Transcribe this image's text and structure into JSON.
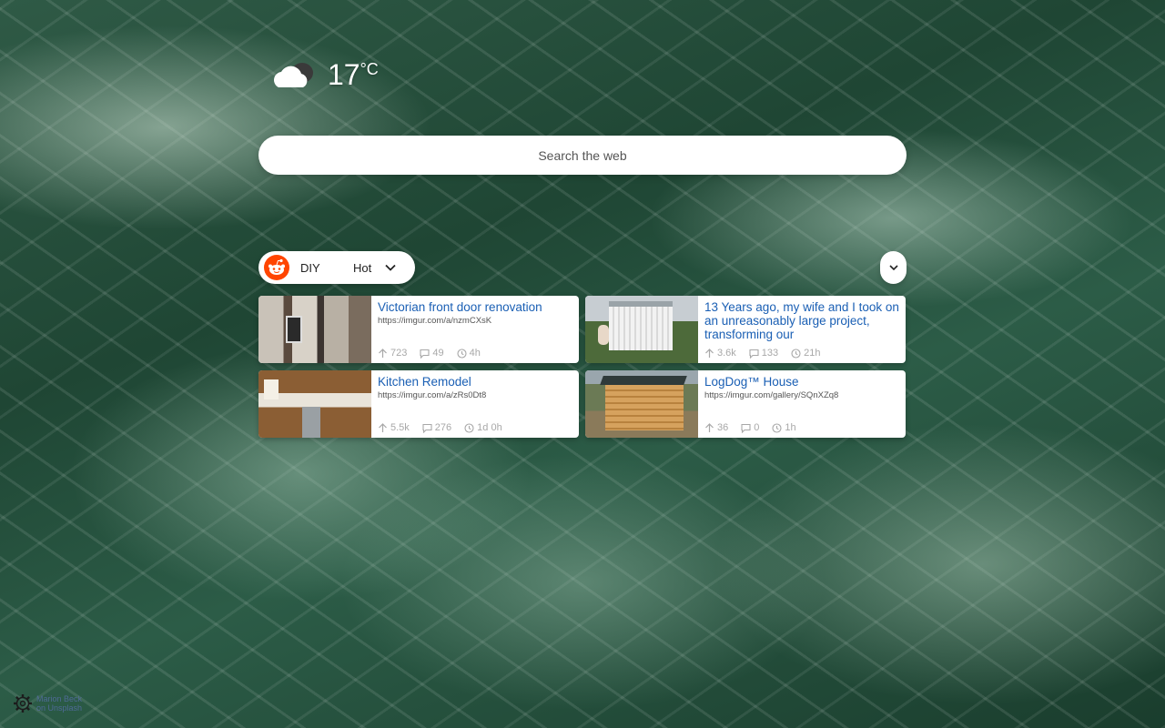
{
  "weather": {
    "icon": "cloud-sun-icon",
    "temperature": "17",
    "unit": "°C"
  },
  "search": {
    "placeholder": "Search the web"
  },
  "reddit": {
    "icon": "reddit-icon",
    "subreddit": "DIY",
    "sort": "Hot"
  },
  "posts": [
    {
      "title": "Victorian front door renovation",
      "url": "https://imgur.com/a/nzmCXsK",
      "upvotes": "723",
      "comments": "49",
      "age": "4h"
    },
    {
      "title": "13 Years ago, my wife and I took on an unreasonably large project, transforming our",
      "url": "",
      "upvotes": "3.6k",
      "comments": "133",
      "age": "21h"
    },
    {
      "title": "Kitchen Remodel",
      "url": "https://imgur.com/a/zRs0Dt8",
      "upvotes": "5.5k",
      "comments": "276",
      "age": "1d 0h"
    },
    {
      "title": "LogDog™ House",
      "url": "https://imgur.com/gallery/SQnXZq8",
      "upvotes": "36",
      "comments": "0",
      "age": "1h"
    }
  ],
  "credit": {
    "line1": "Marion Beck",
    "line2": "on Unsplash"
  },
  "colors": {
    "link": "#1a5fb4",
    "reddit_orange": "#ff4500",
    "meta_gray": "#a8a8a8"
  }
}
